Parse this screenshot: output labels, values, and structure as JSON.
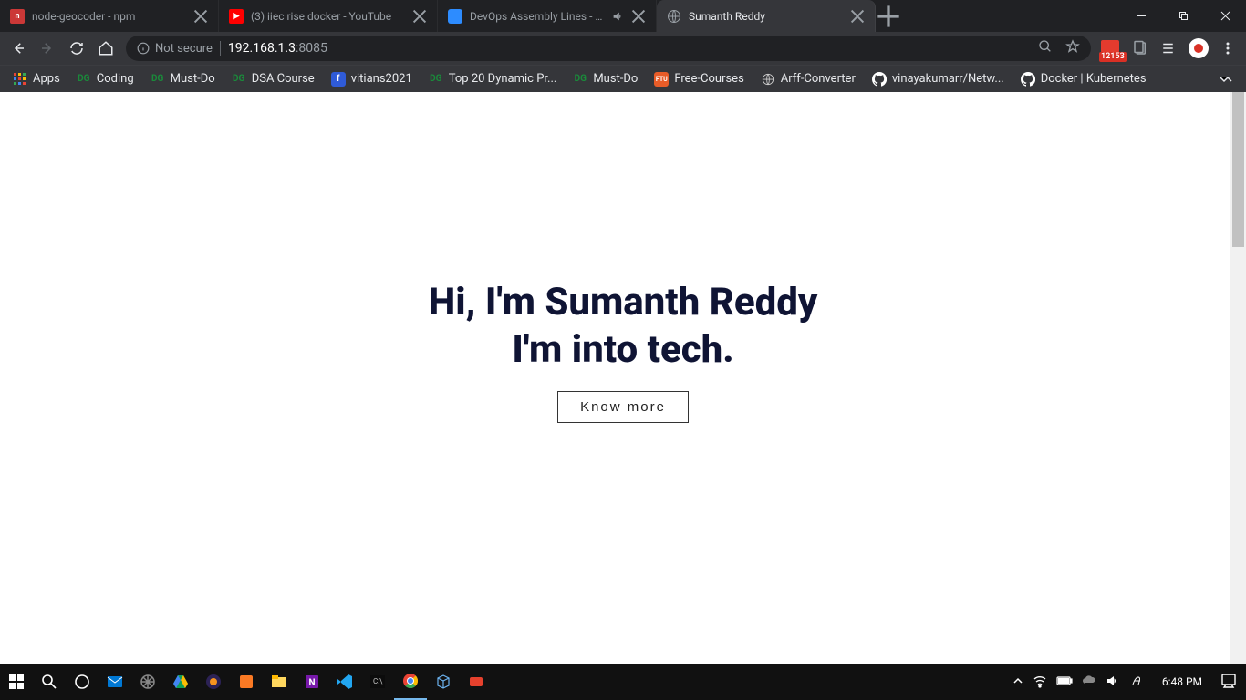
{
  "browser": {
    "tabs": [
      {
        "favicon_bg": "#cb3837",
        "favicon_text": "n",
        "title": "node-geocoder - npm",
        "audio": false,
        "active": false
      },
      {
        "favicon_bg": "#ff0000",
        "favicon_text": "▶",
        "title": "(3) iiec rise docker - YouTube",
        "audio": false,
        "active": false
      },
      {
        "favicon_bg": "#2d8cff",
        "favicon_text": "",
        "title": "DevOps Assembly Lines - Se…",
        "audio": true,
        "active": false
      },
      {
        "favicon_bg": "#777",
        "favicon_text": "",
        "title": "Sumanth Reddy",
        "audio": false,
        "active": true
      }
    ],
    "security_label": "Not secure",
    "url_host": "192.168.1.3",
    "url_port": ":8085",
    "gmail_count": "12153"
  },
  "bookmarks": [
    {
      "icon_bg": "",
      "icon_text": "",
      "label": "Apps",
      "kind": "apps"
    },
    {
      "icon_bg": "#1a8a3a",
      "icon_text": "DG",
      "label": "Coding"
    },
    {
      "icon_bg": "#1a8a3a",
      "icon_text": "DG",
      "label": "Must-Do"
    },
    {
      "icon_bg": "#1a8a3a",
      "icon_text": "DG",
      "label": "DSA Course"
    },
    {
      "icon_bg": "#2f5bd8",
      "icon_text": "",
      "label": "vitians2021",
      "kind": "fb"
    },
    {
      "icon_bg": "#1a8a3a",
      "icon_text": "DG",
      "label": "Top 20 Dynamic Pr..."
    },
    {
      "icon_bg": "#1a8a3a",
      "icon_text": "DG",
      "label": "Must-Do"
    },
    {
      "icon_bg": "#e85c28",
      "icon_text": "FTU",
      "label": "Free-Courses"
    },
    {
      "icon_bg": "",
      "icon_text": "",
      "label": "Arff-Converter",
      "kind": "generic"
    },
    {
      "icon_bg": "",
      "icon_text": "",
      "label": "vinayakumarr/Netw...",
      "kind": "github"
    },
    {
      "icon_bg": "",
      "icon_text": "",
      "label": "Docker | Kubernetes",
      "kind": "github"
    }
  ],
  "page": {
    "hero_line1": "Hi, I'm Sumanth Reddy",
    "hero_line2": "I'm into tech.",
    "cta": "Know more"
  },
  "taskbar": {
    "time": "6:48 PM"
  }
}
